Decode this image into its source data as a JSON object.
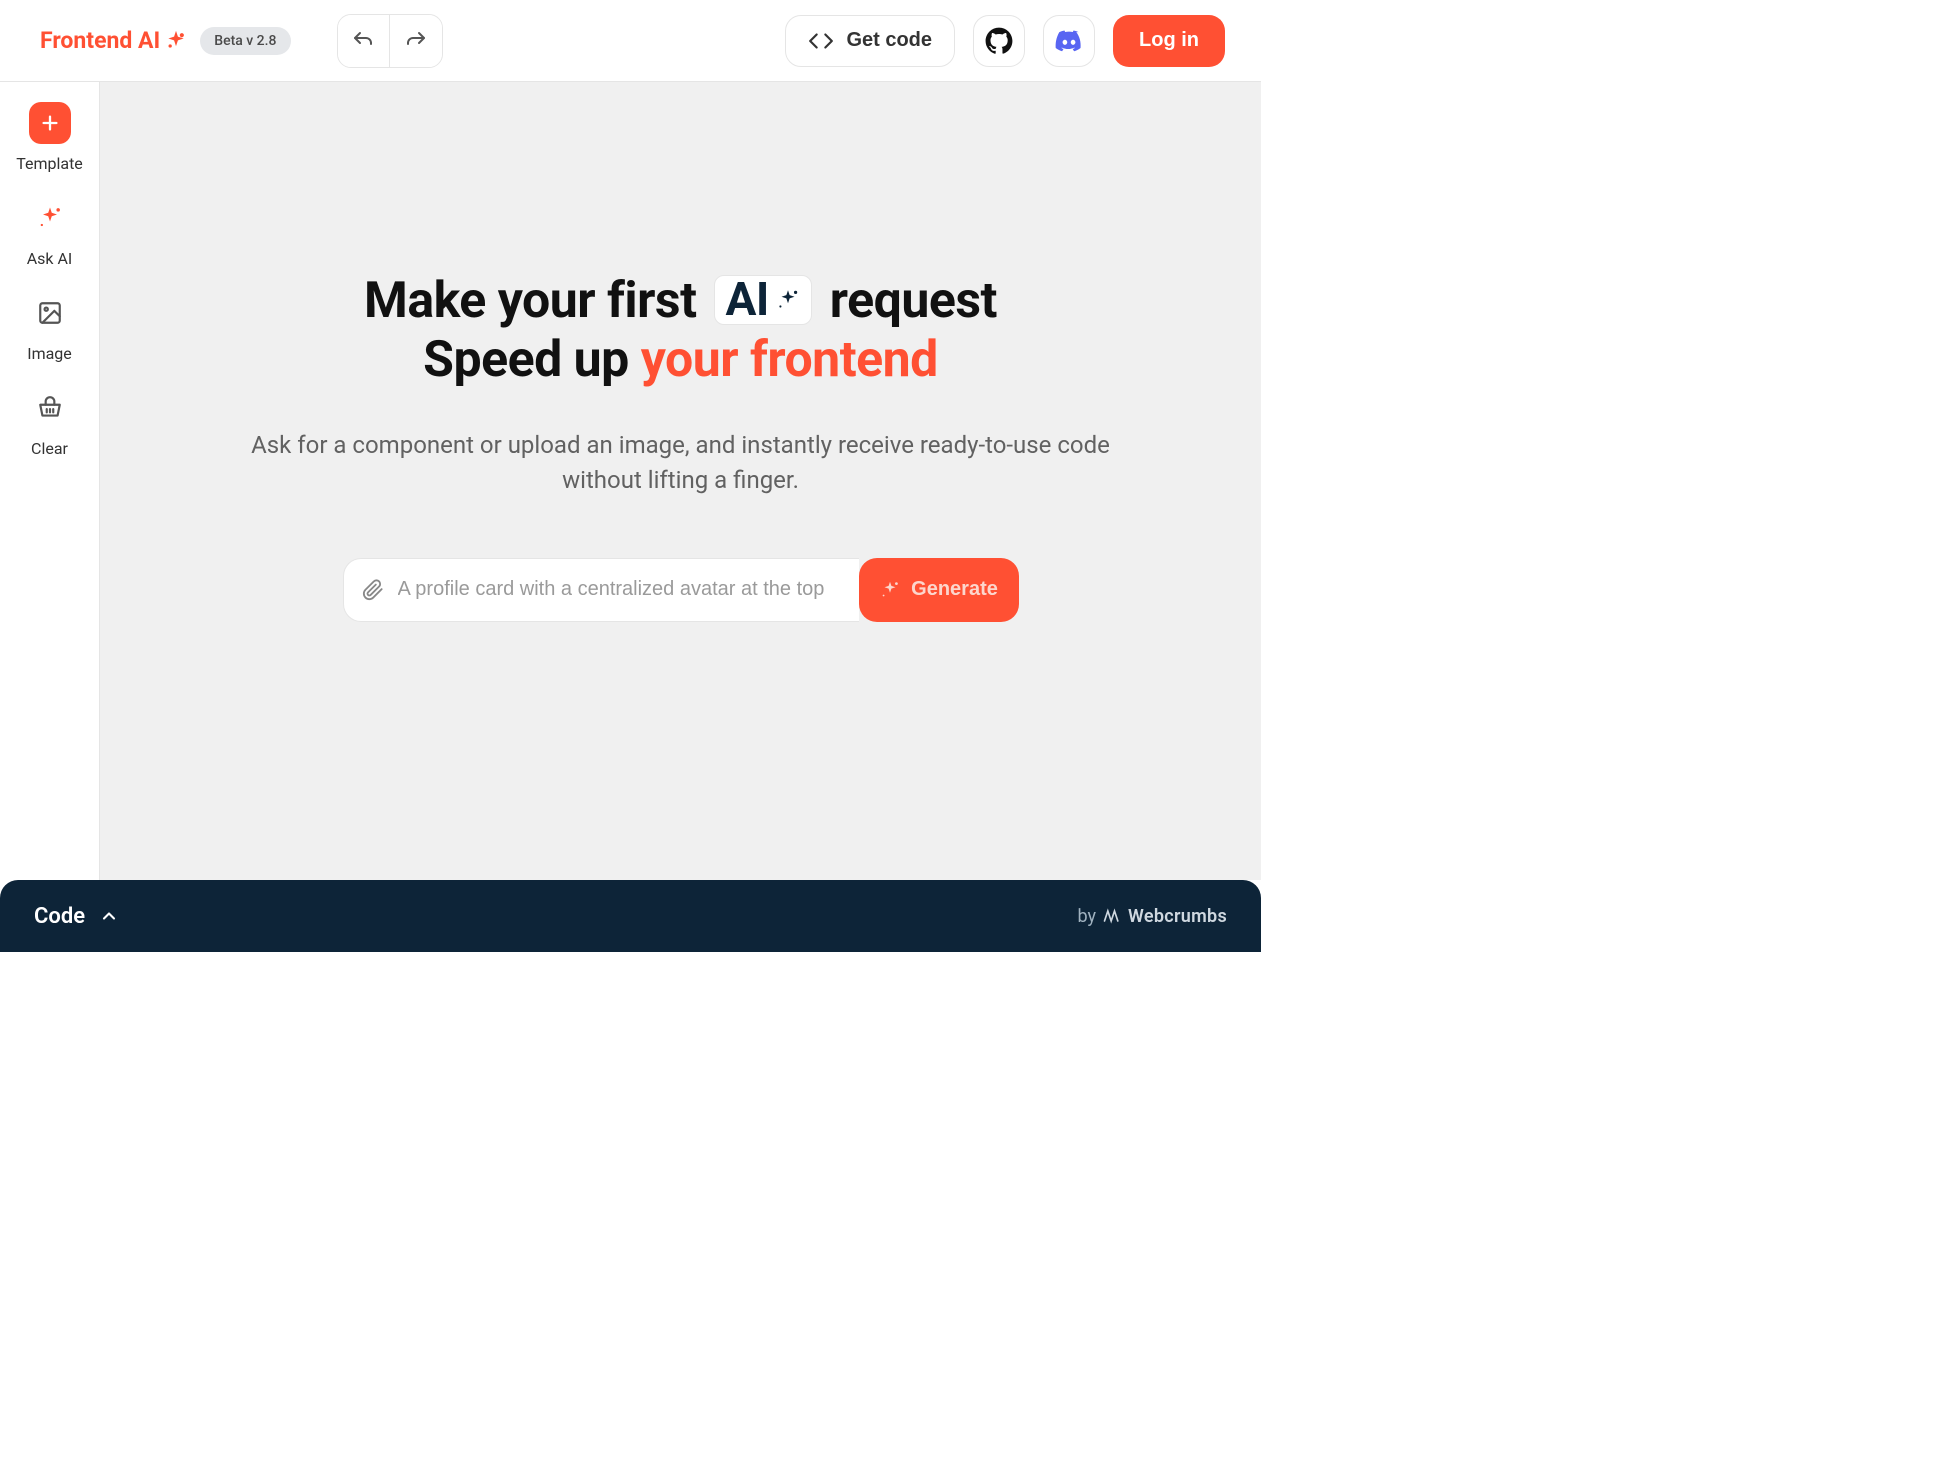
{
  "header": {
    "logo": "Frontend AI",
    "beta_badge": "Beta v 2.8",
    "get_code": "Get code",
    "login": "Log in"
  },
  "sidebar": {
    "items": [
      {
        "label": "Template"
      },
      {
        "label": "Ask AI"
      },
      {
        "label": "Image"
      },
      {
        "label": "Clear"
      }
    ]
  },
  "hero": {
    "line1_pre": "Make your first",
    "line1_ai": "AI",
    "line1_post": "request",
    "line2_pre": "Speed up",
    "line2_accent": "your frontend",
    "subtitle": "Ask for a component or upload an image, and instantly receive ready-to-use code without lifting a finger."
  },
  "prompt": {
    "placeholder": "A profile card with a centralized avatar at the top",
    "generate": "Generate"
  },
  "bottom": {
    "code": "Code",
    "by": "by",
    "brand": "Webcrumbs"
  }
}
